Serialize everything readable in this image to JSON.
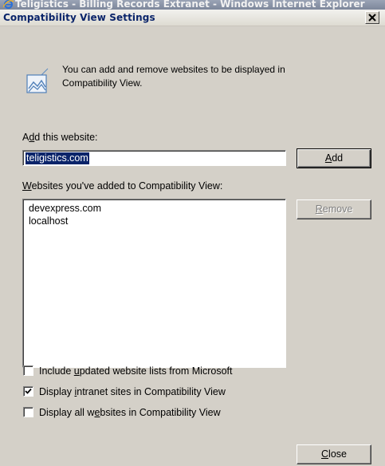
{
  "background_window": {
    "title": "Teligistics - Billing Records Extranet - Windows Internet Explorer"
  },
  "dialog": {
    "title": "Compatibility View Settings",
    "info_text": "You can add and remove websites to be displayed in Compatibility View.",
    "add_label": {
      "pre": "A",
      "key": "d",
      "post": "d this website:"
    },
    "add_input_value": "teligistics.com",
    "add_button": {
      "key": "A",
      "post": "dd"
    },
    "list_label": {
      "key": "W",
      "post": "ebsites you've added to Compatibility View:"
    },
    "sites": [
      "devexpress.com",
      "localhost"
    ],
    "remove_button": {
      "key": "R",
      "post": "emove"
    },
    "checkboxes": [
      {
        "pre": "Include ",
        "key": "u",
        "post": "pdated website lists from Microsoft",
        "checked": false
      },
      {
        "pre": "Display ",
        "key": "i",
        "post": "ntranet sites in Compatibility View",
        "checked": true
      },
      {
        "pre": "Display all w",
        "key": "e",
        "post": "bsites in Compatibility View",
        "checked": false
      }
    ],
    "close_button": {
      "key": "C",
      "post": "lose"
    }
  },
  "colors": {
    "dialog_bg": "#d4d0c8",
    "selection": "#0a246a",
    "title_text": "#0a246a"
  },
  "icons": [
    "internet-explorer-icon",
    "close-icon",
    "compat-view-icon",
    "checkmark-icon"
  ]
}
